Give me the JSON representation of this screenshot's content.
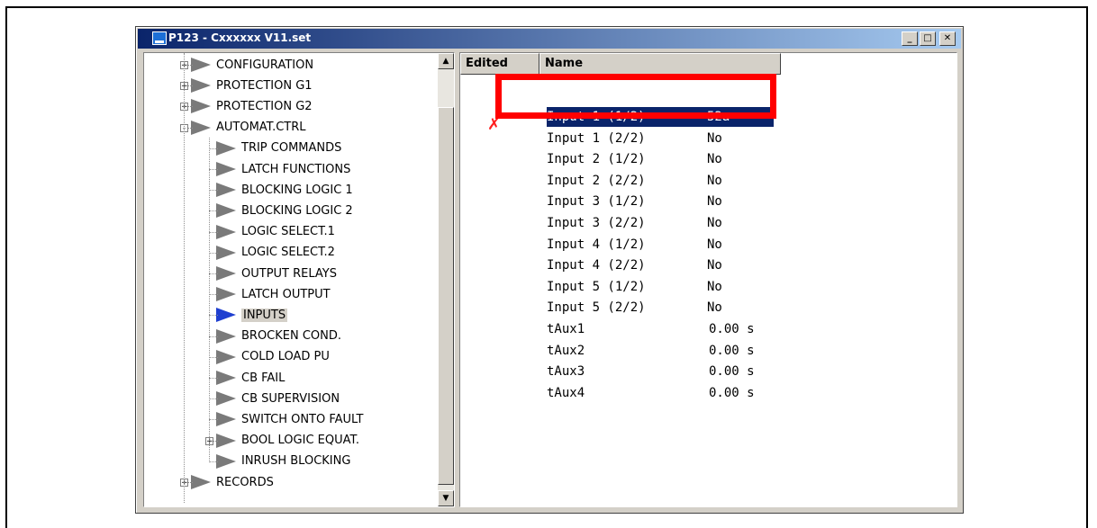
{
  "window": {
    "title": "P123 - Cxxxxxx V11.set",
    "buttons": {
      "minimize": "_",
      "maximize": "□",
      "close": "✕"
    }
  },
  "tree": {
    "items": [
      {
        "label": "CONFIGURATION",
        "expander": "+"
      },
      {
        "label": "PROTECTION G1",
        "expander": "+"
      },
      {
        "label": "PROTECTION G2",
        "expander": "+"
      },
      {
        "label": "AUTOMAT.CTRL",
        "expander": "-"
      },
      {
        "label": "TRIP COMMANDS"
      },
      {
        "label": "LATCH FUNCTIONS"
      },
      {
        "label": "BLOCKING LOGIC 1"
      },
      {
        "label": "BLOCKING LOGIC 2"
      },
      {
        "label": "LOGIC SELECT.1"
      },
      {
        "label": "LOGIC SELECT.2"
      },
      {
        "label": "OUTPUT RELAYS"
      },
      {
        "label": "LATCH OUTPUT"
      },
      {
        "label": "INPUTS",
        "selected": true
      },
      {
        "label": "BROCKEN COND."
      },
      {
        "label": "COLD LOAD PU"
      },
      {
        "label": "CB FAIL"
      },
      {
        "label": "CB SUPERVISION"
      },
      {
        "label": "SWITCH ONTO FAULT"
      },
      {
        "label": "BOOL LOGIC EQUAT.",
        "expander": "+"
      },
      {
        "label": "INRUSH BLOCKING"
      },
      {
        "label": "RECORDS",
        "expander": "+"
      }
    ]
  },
  "list": {
    "columns": [
      "Edited",
      "Name"
    ],
    "edit_marker": "✗",
    "rows": [
      {
        "name": "Input 1 (1/2)",
        "value": "52a",
        "selected": true
      },
      {
        "name": "Input 1 (2/2)",
        "value": "No"
      },
      {
        "name": "Input 2 (1/2)",
        "value": "No"
      },
      {
        "name": "Input 2 (2/2)",
        "value": "No"
      },
      {
        "name": "Input 3 (1/2)",
        "value": "No"
      },
      {
        "name": "Input 3 (2/2)",
        "value": "No"
      },
      {
        "name": "Input 4 (1/2)",
        "value": "No"
      },
      {
        "name": "Input 4 (2/2)",
        "value": "No"
      },
      {
        "name": "Input 5 (1/2)",
        "value": "No"
      },
      {
        "name": "Input 5 (2/2)",
        "value": "No"
      },
      {
        "name": "tAux1",
        "value": "0.00 s"
      },
      {
        "name": "tAux2",
        "value": "0.00 s"
      },
      {
        "name": "tAux3",
        "value": "0.00 s"
      },
      {
        "name": "tAux4",
        "value": "0.00 s"
      }
    ]
  },
  "colors": {
    "highlight_box": "#ff0000",
    "selection": "#0a246a",
    "selected_arrow": "#1f3fd0"
  }
}
